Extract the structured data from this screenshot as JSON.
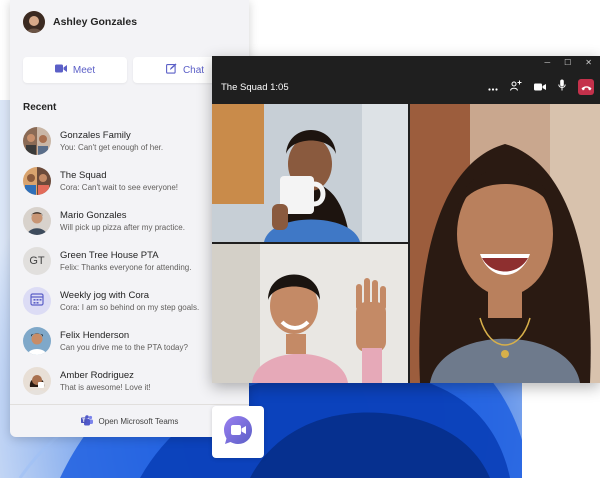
{
  "user": {
    "name": "Ashley Gonzales"
  },
  "actions": {
    "meet_label": "Meet",
    "chat_label": "Chat"
  },
  "recent": {
    "label": "Recent",
    "contacts": [
      {
        "name": "Gonzales Family",
        "message": "You: Can't get enough of her."
      },
      {
        "name": "The Squad",
        "message": "Cora: Can't wait to see everyone!"
      },
      {
        "name": "Mario Gonzales",
        "message": "Will pick up pizza after my practice."
      },
      {
        "name": "Green Tree House PTA",
        "message": "Felix: Thanks everyone for attending.",
        "initials": "GT"
      },
      {
        "name": "Weekly jog with Cora",
        "message": "Cora: I am so behind on my step goals."
      },
      {
        "name": "Felix Henderson",
        "message": "Can you drive me to the PTA today?"
      },
      {
        "name": "Amber Rodriguez",
        "message": "That is awesome! Love it!"
      }
    ]
  },
  "footer": {
    "open_teams_label": "Open Microsoft Teams"
  },
  "call": {
    "title": "The Squad 1:05"
  },
  "colors": {
    "accent": "#5b5fc7",
    "hangup": "#c4314b",
    "call_bg": "#1f1f1f"
  }
}
